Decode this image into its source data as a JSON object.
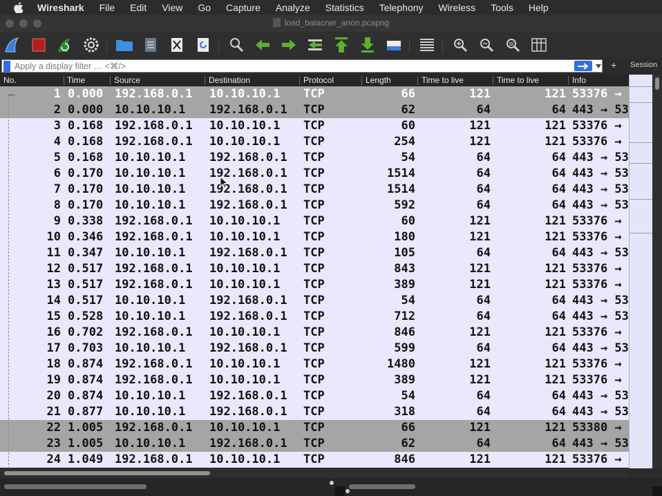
{
  "menubar": {
    "app_name": "Wireshark",
    "items": [
      "File",
      "Edit",
      "View",
      "Go",
      "Capture",
      "Analyze",
      "Statistics",
      "Telephony",
      "Wireless",
      "Tools",
      "Help"
    ]
  },
  "window": {
    "title": "load_balacner_anon.pcapng"
  },
  "toolbar": {
    "icons": [
      "shark-fin-start-icon",
      "stop-square-icon",
      "restart-fin-icon",
      "capture-options-gear-icon",
      "open-folder-icon",
      "save-file-icon",
      "close-file-icon",
      "reload-file-icon",
      "find-packet-icon",
      "go-back-arrow-icon",
      "go-forward-arrow-icon",
      "go-to-packet-icon",
      "go-first-packet-icon",
      "go-last-packet-icon",
      "auto-scroll-icon",
      "colorize-icon",
      "zoom-in-icon",
      "zoom-out-icon",
      "zoom-normal-icon",
      "resize-columns-icon"
    ]
  },
  "filter": {
    "placeholder": "Apply a display filter … <⌘/>",
    "plus_label": "+",
    "session_label": "Session"
  },
  "colors": {
    "row_bg": "#e9e8fd",
    "selected_bg": "#a5a5a5",
    "accent": "#2f6de1"
  },
  "columns": [
    "No.",
    "Time",
    "Source",
    "Destination",
    "Protocol",
    "Length",
    "Time to live",
    "Time to live",
    "Info"
  ],
  "rows": [
    {
      "no": "1",
      "time": "0.000",
      "src": "192.168.0.1",
      "dst": "10.10.10.1",
      "proto": "TCP",
      "len": "66",
      "ttl1": "121",
      "ttl2": "121",
      "info": "53376 →",
      "style": "first"
    },
    {
      "no": "2",
      "time": "0.000",
      "src": "10.10.10.1",
      "dst": "192.168.0.1",
      "proto": "TCP",
      "len": "62",
      "ttl1": "64",
      "ttl2": "64",
      "info": "443 → 53",
      "style": "gray"
    },
    {
      "no": "3",
      "time": "0.168",
      "src": "192.168.0.1",
      "dst": "10.10.10.1",
      "proto": "TCP",
      "len": "60",
      "ttl1": "121",
      "ttl2": "121",
      "info": "53376 →",
      "style": "normal"
    },
    {
      "no": "4",
      "time": "0.168",
      "src": "192.168.0.1",
      "dst": "10.10.10.1",
      "proto": "TCP",
      "len": "254",
      "ttl1": "121",
      "ttl2": "121",
      "info": "53376 →",
      "style": "normal"
    },
    {
      "no": "5",
      "time": "0.168",
      "src": "10.10.10.1",
      "dst": "192.168.0.1",
      "proto": "TCP",
      "len": "54",
      "ttl1": "64",
      "ttl2": "64",
      "info": "443 → 53",
      "style": "normal"
    },
    {
      "no": "6",
      "time": "0.170",
      "src": "10.10.10.1",
      "dst": "192.168.0.1",
      "proto": "TCP",
      "len": "1514",
      "ttl1": "64",
      "ttl2": "64",
      "info": "443 → 53",
      "style": "normal"
    },
    {
      "no": "7",
      "time": "0.170",
      "src": "10.10.10.1",
      "dst": "192.168.0.1",
      "proto": "TCP",
      "len": "1514",
      "ttl1": "64",
      "ttl2": "64",
      "info": "443 → 53",
      "style": "normal"
    },
    {
      "no": "8",
      "time": "0.170",
      "src": "10.10.10.1",
      "dst": "192.168.0.1",
      "proto": "TCP",
      "len": "592",
      "ttl1": "64",
      "ttl2": "64",
      "info": "443 → 53",
      "style": "normal"
    },
    {
      "no": "9",
      "time": "0.338",
      "src": "192.168.0.1",
      "dst": "10.10.10.1",
      "proto": "TCP",
      "len": "60",
      "ttl1": "121",
      "ttl2": "121",
      "info": "53376 →",
      "style": "normal"
    },
    {
      "no": "10",
      "time": "0.346",
      "src": "192.168.0.1",
      "dst": "10.10.10.1",
      "proto": "TCP",
      "len": "180",
      "ttl1": "121",
      "ttl2": "121",
      "info": "53376 →",
      "style": "normal"
    },
    {
      "no": "11",
      "time": "0.347",
      "src": "10.10.10.1",
      "dst": "192.168.0.1",
      "proto": "TCP",
      "len": "105",
      "ttl1": "64",
      "ttl2": "64",
      "info": "443 → 53",
      "style": "normal"
    },
    {
      "no": "12",
      "time": "0.517",
      "src": "192.168.0.1",
      "dst": "10.10.10.1",
      "proto": "TCP",
      "len": "843",
      "ttl1": "121",
      "ttl2": "121",
      "info": "53376 →",
      "style": "normal"
    },
    {
      "no": "13",
      "time": "0.517",
      "src": "192.168.0.1",
      "dst": "10.10.10.1",
      "proto": "TCP",
      "len": "389",
      "ttl1": "121",
      "ttl2": "121",
      "info": "53376 →",
      "style": "normal"
    },
    {
      "no": "14",
      "time": "0.517",
      "src": "10.10.10.1",
      "dst": "192.168.0.1",
      "proto": "TCP",
      "len": "54",
      "ttl1": "64",
      "ttl2": "64",
      "info": "443 → 53",
      "style": "normal"
    },
    {
      "no": "15",
      "time": "0.528",
      "src": "10.10.10.1",
      "dst": "192.168.0.1",
      "proto": "TCP",
      "len": "712",
      "ttl1": "64",
      "ttl2": "64",
      "info": "443 → 53",
      "style": "normal"
    },
    {
      "no": "16",
      "time": "0.702",
      "src": "192.168.0.1",
      "dst": "10.10.10.1",
      "proto": "TCP",
      "len": "846",
      "ttl1": "121",
      "ttl2": "121",
      "info": "53376 →",
      "style": "normal"
    },
    {
      "no": "17",
      "time": "0.703",
      "src": "10.10.10.1",
      "dst": "192.168.0.1",
      "proto": "TCP",
      "len": "599",
      "ttl1": "64",
      "ttl2": "64",
      "info": "443 → 53",
      "style": "normal"
    },
    {
      "no": "18",
      "time": "0.874",
      "src": "192.168.0.1",
      "dst": "10.10.10.1",
      "proto": "TCP",
      "len": "1480",
      "ttl1": "121",
      "ttl2": "121",
      "info": "53376 →",
      "style": "normal"
    },
    {
      "no": "19",
      "time": "0.874",
      "src": "192.168.0.1",
      "dst": "10.10.10.1",
      "proto": "TCP",
      "len": "389",
      "ttl1": "121",
      "ttl2": "121",
      "info": "53376 →",
      "style": "normal"
    },
    {
      "no": "20",
      "time": "0.874",
      "src": "10.10.10.1",
      "dst": "192.168.0.1",
      "proto": "TCP",
      "len": "54",
      "ttl1": "64",
      "ttl2": "64",
      "info": "443 → 53",
      "style": "normal"
    },
    {
      "no": "21",
      "time": "0.877",
      "src": "10.10.10.1",
      "dst": "192.168.0.1",
      "proto": "TCP",
      "len": "318",
      "ttl1": "64",
      "ttl2": "64",
      "info": "443 → 53",
      "style": "normal"
    },
    {
      "no": "22",
      "time": "1.005",
      "src": "192.168.0.1",
      "dst": "10.10.10.1",
      "proto": "TCP",
      "len": "66",
      "ttl1": "121",
      "ttl2": "121",
      "info": "53380 →",
      "style": "gray"
    },
    {
      "no": "23",
      "time": "1.005",
      "src": "10.10.10.1",
      "dst": "192.168.0.1",
      "proto": "TCP",
      "len": "62",
      "ttl1": "64",
      "ttl2": "64",
      "info": "443 → 53",
      "style": "gray"
    },
    {
      "no": "24",
      "time": "1.049",
      "src": "192.168.0.1",
      "dst": "10.10.10.1",
      "proto": "TCP",
      "len": "846",
      "ttl1": "121",
      "ttl2": "121",
      "info": "53376 →",
      "style": "normal"
    }
  ]
}
